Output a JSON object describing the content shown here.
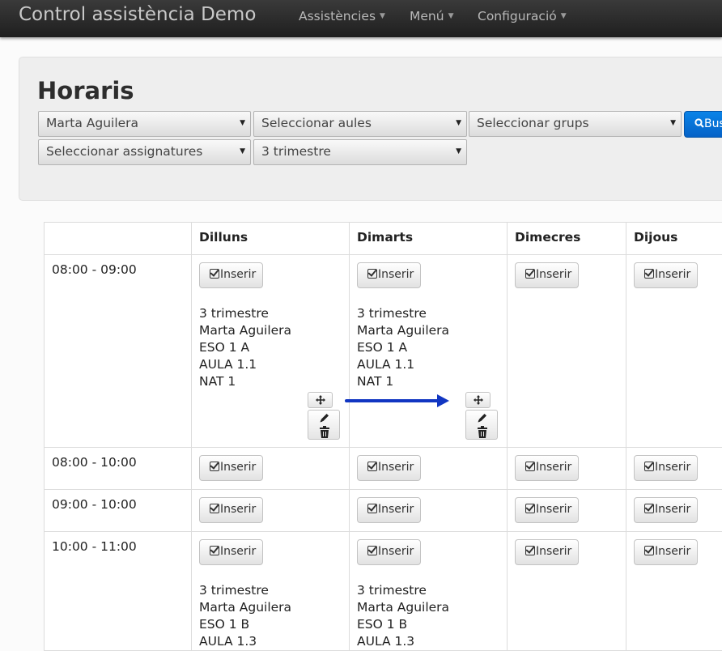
{
  "navbar": {
    "brand": "Control assistència Demo",
    "menus": [
      "Assistències",
      "Menú",
      "Configuració"
    ]
  },
  "page": {
    "title": "Horaris",
    "filters": {
      "teacher": "Marta Aguilera",
      "rooms": "Seleccionar aules",
      "groups": "Seleccionar grups",
      "subjects": "Seleccionar assignatures",
      "term": "3 trimestre"
    },
    "search_label": "Bus"
  },
  "table": {
    "days": [
      "Dilluns",
      "Dimarts",
      "Dimecres",
      "Dijous"
    ],
    "times": [
      "08:00 - 09:00",
      "08:00 - 10:00",
      "09:00 - 10:00",
      "10:00 - 11:00"
    ],
    "insert_label": "Inserir",
    "entries": {
      "r1_mon": [
        "3 trimestre",
        "Marta Aguilera",
        "ESO 1 A",
        "AULA 1.1",
        "NAT 1"
      ],
      "r1_tue": [
        "3 trimestre",
        "Marta Aguilera",
        "ESO 1 A",
        "AULA 1.1",
        "NAT 1"
      ],
      "r4_mon": [
        "3 trimestre",
        "Marta Aguilera",
        "ESO 1 B",
        "AULA 1.3"
      ],
      "r4_tue": [
        "3 trimestre",
        "Marta Aguilera",
        "ESO 1 B",
        "AULA 1.3"
      ]
    }
  },
  "icons": {
    "move": "move-icon",
    "edit": "pencil-icon",
    "delete": "trash-icon",
    "insert": "check-square-icon",
    "search": "search-icon"
  },
  "colors": {
    "primary": "#0562c7",
    "arrow": "#1136c2"
  }
}
